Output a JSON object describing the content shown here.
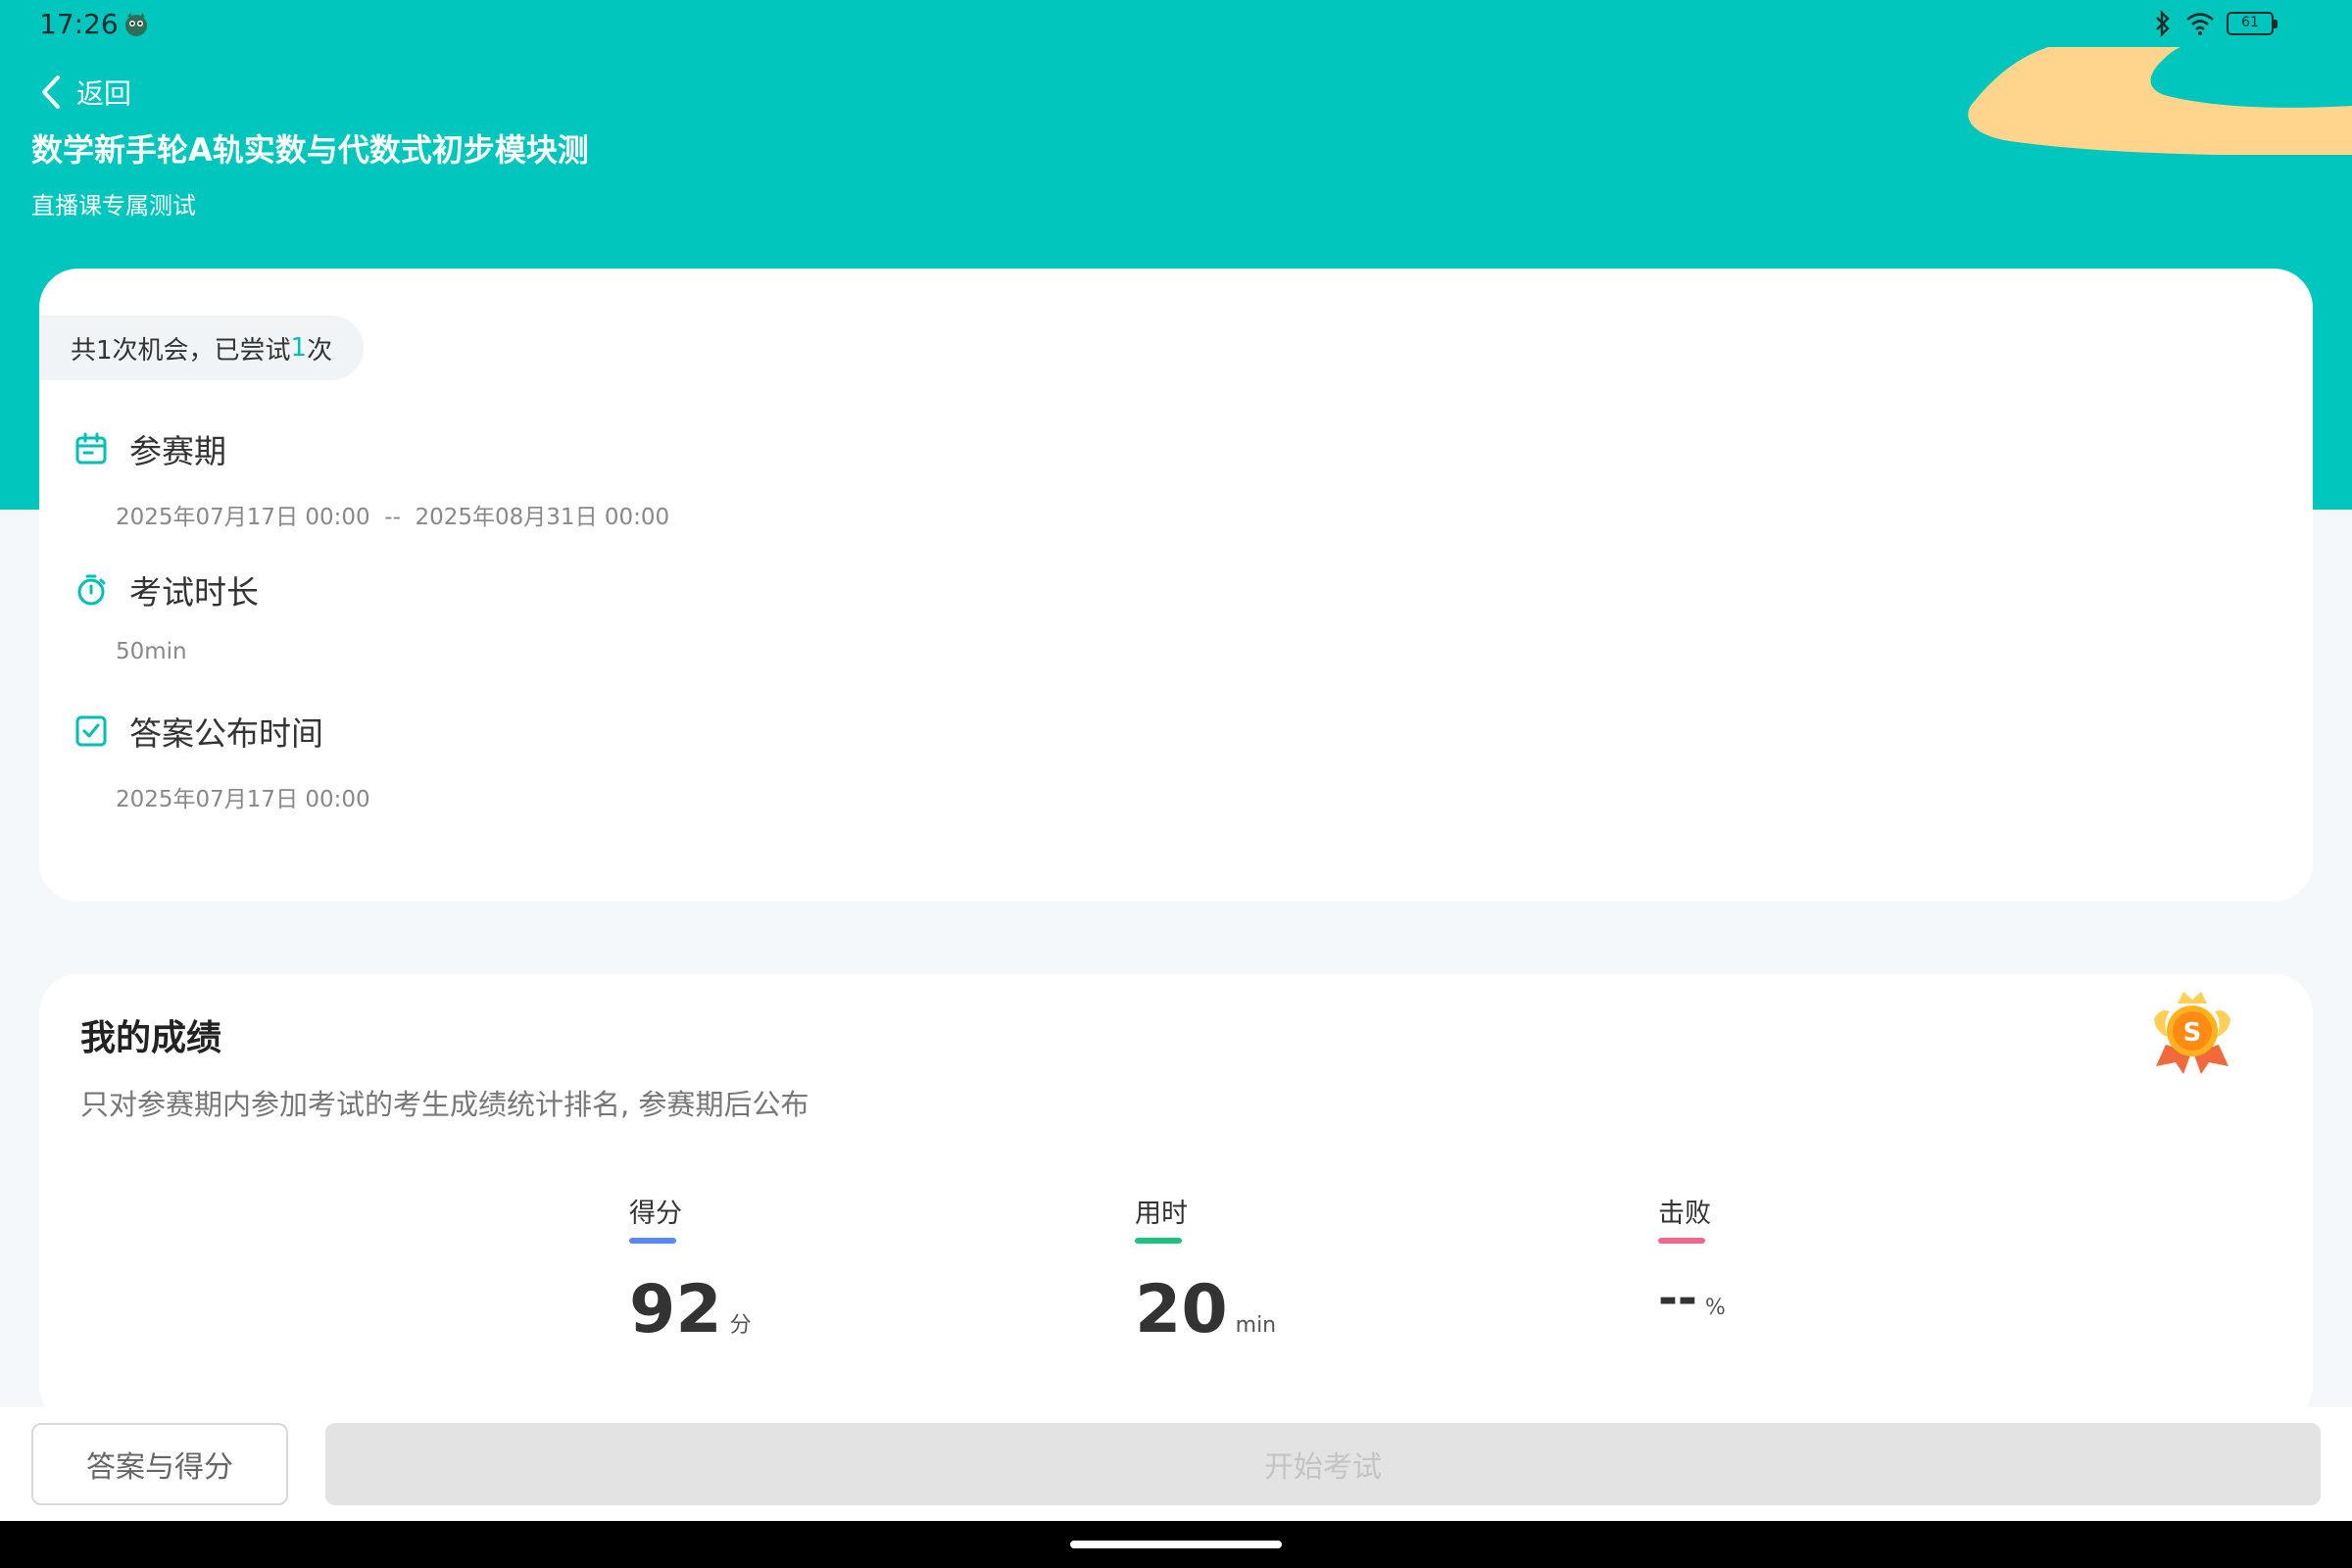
{
  "status_bar": {
    "time": "17:26",
    "battery": "61",
    "icons": [
      "app-notification-icon",
      "bluetooth-icon",
      "wifi-icon",
      "battery-icon"
    ]
  },
  "header": {
    "back_label": "返回",
    "title": "数学新手轮A轨实数与代数式初步模块测",
    "subtitle": "直播课专属测试"
  },
  "attempts": {
    "prefix": "共1次机会，已尝试",
    "count": "1",
    "suffix": "次"
  },
  "info": {
    "period": {
      "title": "参赛期",
      "value": "2025年07月17日 00:00  --  2025年08月31日 00:00",
      "icon": "calendar-icon"
    },
    "duration": {
      "title": "考试时长",
      "value": "50min",
      "icon": "stopwatch-icon"
    },
    "answer_release": {
      "title": "答案公布时间",
      "value": "2025年07月17日 00:00",
      "icon": "checklist-icon"
    }
  },
  "score": {
    "title": "我的成绩",
    "description": "只对参赛期内参加考试的考生成绩统计排名, 参赛期后公布",
    "stats": [
      {
        "label": "得分",
        "value": "92",
        "unit": "分",
        "accent": "#5b86f5"
      },
      {
        "label": "用时",
        "value": "20",
        "unit": "min",
        "accent": "#1bc47d"
      },
      {
        "label": "击败",
        "value": "--",
        "unit": "%",
        "accent": "#f2688d"
      }
    ]
  },
  "actions": {
    "answers_label": "答案与得分",
    "start_label": "开始考试"
  },
  "colors": {
    "brand": "#00c6bd",
    "sand": "#ffd58d",
    "disabled_button": "#e3e3e3"
  }
}
